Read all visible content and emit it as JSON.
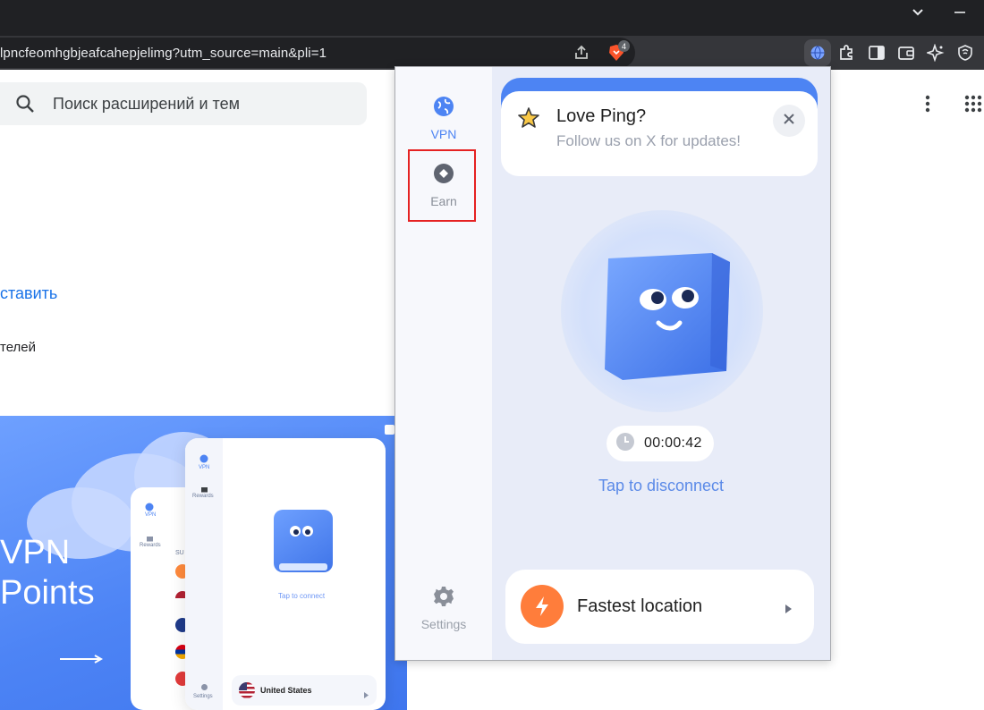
{
  "browser": {
    "url": "lpncfeomhgbjeafcahepjelimg?utm_source=main&pli=1",
    "shield_badge": "4"
  },
  "page": {
    "search_placeholder": "Поиск расширений и тем",
    "install_link": "ставить",
    "users_text": "телей"
  },
  "banner": {
    "title_line1": "VPN",
    "title_line2": "Points",
    "mock_nav_vpn": "VPN",
    "mock_nav_rewards": "Rewards",
    "mock_nav_settings": "Settings",
    "mock_tap": "Tap to connect",
    "mock_location": "United States",
    "mock_partial": "SU"
  },
  "popup": {
    "nav": {
      "vpn": "VPN",
      "earn": "Earn",
      "settings": "Settings"
    },
    "notification": {
      "title": "Love Ping?",
      "subtitle": "Follow us on X for updates!"
    },
    "timer": "00:00:42",
    "status_action": "Tap to disconnect",
    "location": "Fastest location"
  },
  "colors": {
    "accent": "#4d84f3",
    "action_text": "#5b8ae8",
    "bolt": "#ff7d3b",
    "highlight": "#e52222"
  }
}
